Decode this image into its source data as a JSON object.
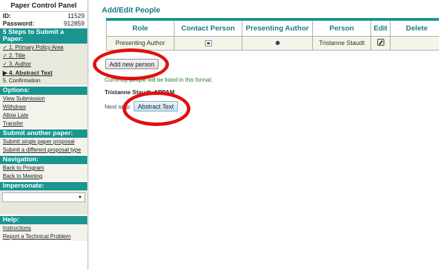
{
  "sidebar": {
    "title": "Paper Control Panel",
    "id_label": "ID:",
    "id_value": "11529",
    "password_label": "Password:",
    "password_value": "912859",
    "steps_header": "5 Steps to Submit a Paper:",
    "steps": [
      {
        "label": "✓ 1. Primary Policy Area"
      },
      {
        "label": "✓ 2. Title"
      },
      {
        "label": "✓ 3. Author"
      },
      {
        "label": "▶ 4. Abstract Text"
      },
      {
        "label": "5. Confirmation"
      }
    ],
    "options_header": "Options:",
    "options": [
      "View Submission",
      "Withdraw",
      "Allow Late",
      "Transfer"
    ],
    "submit_header": "Submit another paper:",
    "submit_links": [
      "Submit single paper proposal",
      "Submit a different proposal type"
    ],
    "nav_header": "Navigation:",
    "nav_links": [
      "Back to Program",
      "Back to Meeting"
    ],
    "impersonate_header": "Impersonate:",
    "impersonate_value": "",
    "help_header": "Help:",
    "help_links": [
      "Instructions",
      "Report a Technical Problem"
    ]
  },
  "main": {
    "title": "Add/Edit People",
    "table": {
      "headers": [
        "Role",
        "Contact Person",
        "Presenting Author",
        "Person",
        "Edit",
        "Delete"
      ],
      "rows": [
        {
          "role": "Presenting Author",
          "contact": true,
          "presenting": true,
          "person": "Tristanne Staudt"
        }
      ]
    },
    "add_button": "Add new person",
    "format_note": "Currently, people will be listed in this format:",
    "format_example": "Tristanne Staudt, APPAM",
    "next_step_label": "Next step:",
    "next_button": "Abstract Text"
  },
  "colors": {
    "accent": "#1a9590",
    "title_text": "#1a7a85",
    "annotation_ring": "#e01010"
  }
}
